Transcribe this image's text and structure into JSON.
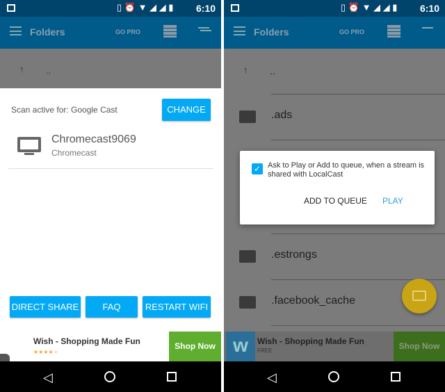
{
  "status": {
    "time": "6:10",
    "battery": "87"
  },
  "toolbar": {
    "title": "Folders",
    "go_pro": "GO PRO"
  },
  "left": {
    "up_label": "..",
    "scan_label": "Scan active for: Google Cast",
    "change_button": "CHANGE",
    "device": {
      "name": "Chromecast9069",
      "type": "Chromecast"
    },
    "buttons": [
      "DIRECT SHARE",
      "FAQ",
      "RESTART WIFI"
    ],
    "ad": {
      "title": "Wish - Shopping Made Fun",
      "rating": 4,
      "cta": "Shop Now"
    }
  },
  "right": {
    "folders": [
      "..",
      ".ads",
      ".estrongs",
      ".facebook_cache"
    ],
    "dialog": {
      "text": "Ask to Play or Add to queue, when a stream is shared with LocalCast",
      "checked": true,
      "add_to_queue": "ADD TO QUEUE",
      "play": "PLAY"
    },
    "ad": {
      "title": "Wish - Shopping Made Fun",
      "subtitle": "FREE",
      "cta": "Shop Now"
    }
  },
  "colors": {
    "accent": "#03a9f4",
    "toolbar": "#005a8a",
    "fab": "#c9a414",
    "shop_now": "#5fae2f"
  }
}
